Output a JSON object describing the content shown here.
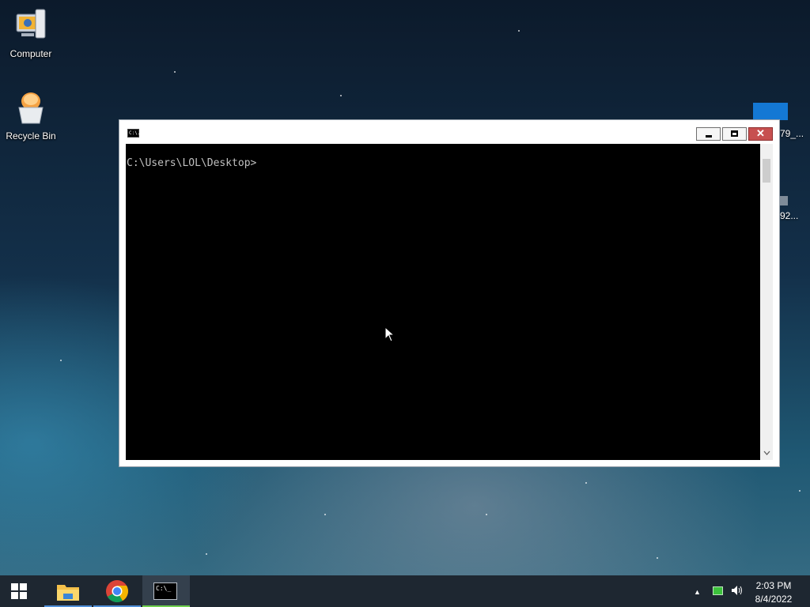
{
  "desktop": {
    "icons": [
      {
        "label": "Computer",
        "icon": "computer-icon"
      },
      {
        "label": "Recycle Bin",
        "icon": "recycle-bin-icon"
      }
    ],
    "partial_icons": [
      {
        "label": "79_...",
        "icon": "file-icon"
      },
      {
        "label": "92...",
        "icon": "file-icon"
      }
    ]
  },
  "window": {
    "title_icon_text": "C:\\.",
    "buttons": {
      "minimize": "minimize",
      "maximize": "maximize",
      "close": "✕"
    },
    "console_text": "C:\\Users\\LOL\\Desktop>"
  },
  "taskbar": {
    "items": [
      {
        "icon": "file-explorer-icon",
        "accent": "#4f8fd8"
      },
      {
        "icon": "chrome-icon",
        "accent": "#4f8fd8"
      },
      {
        "icon": "cmd-icon",
        "accent": "#6fcf4f",
        "text": "C:\\_"
      }
    ],
    "tray": {
      "arrow": "▲",
      "volume": "🔊"
    },
    "clock": {
      "time": "2:03 PM",
      "date": "8/4/2022"
    }
  },
  "colors": {
    "close_button": "#c75050",
    "taskbar": "#1e2731",
    "console_bg": "#000000"
  }
}
